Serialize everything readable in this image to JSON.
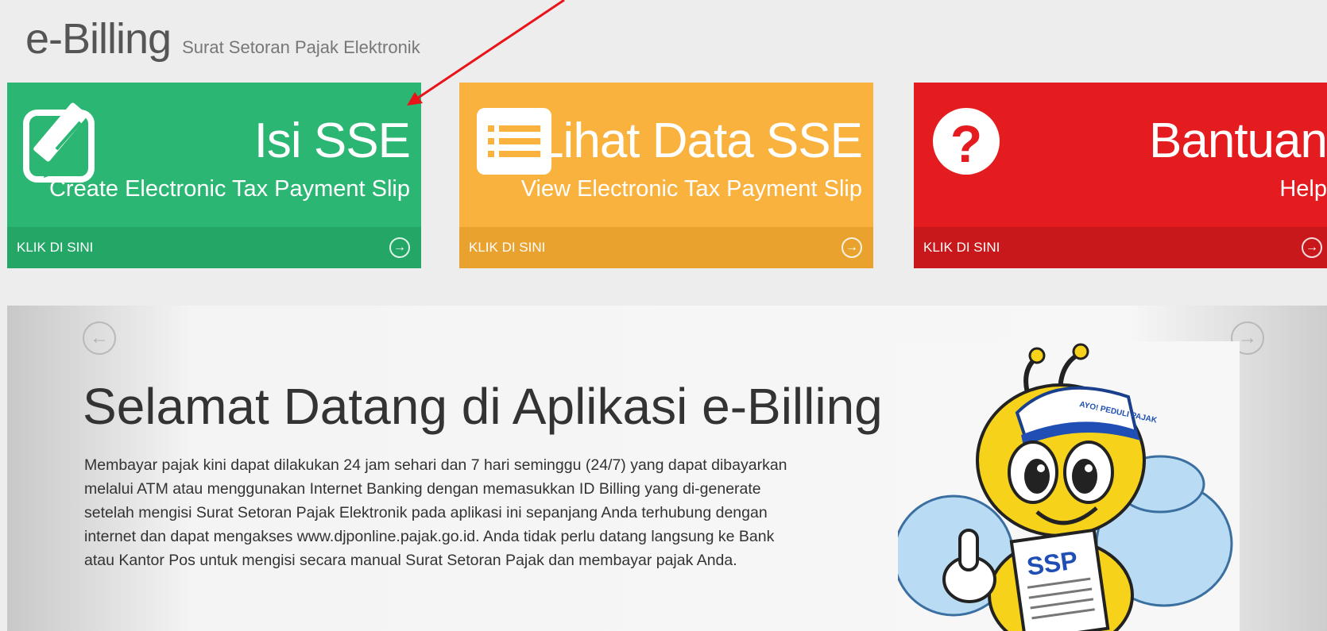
{
  "header": {
    "title": "e-Billing",
    "subtitle": "Surat Setoran Pajak Elektronik"
  },
  "tiles": [
    {
      "title": "Isi SSE",
      "caption": "Create Electronic Tax Payment Slip",
      "link": "KLIK DI SINI",
      "icon": "edit-icon",
      "color": "#2bb673"
    },
    {
      "title": "Lihat Data SSE",
      "caption": "View Electronic Tax Payment Slip",
      "link": "KLIK DI SINI",
      "icon": "list-icon",
      "color": "#f9b23e"
    },
    {
      "title": "Bantuan",
      "caption": "Help",
      "link": "KLIK DI SINI",
      "icon": "question-icon",
      "color": "#e41b1f"
    }
  ],
  "carousel": {
    "title": "Selamat Datang di Aplikasi e-Billing",
    "text": "Membayar pajak kini dapat dilakukan 24 jam sehari dan 7 hari seminggu (24/7) yang dapat dibayarkan melalui ATM atau menggunakan Internet Banking dengan memasukkan ID Billing yang di-generate setelah mengisi Surat Setoran Pajak Elektronik pada aplikasi ini sepanjang Anda terhubung dengan internet dan dapat mengakses www.djponline.pajak.go.id. Anda tidak perlu datang langsung ke Bank atau Kantor Pos untuk mengisi secara manual Surat Setoran Pajak dan membayar pajak Anda.",
    "mascot": {
      "sign_text": "SSP",
      "cap_text": "AYO! PEDULI PAJAK"
    }
  }
}
